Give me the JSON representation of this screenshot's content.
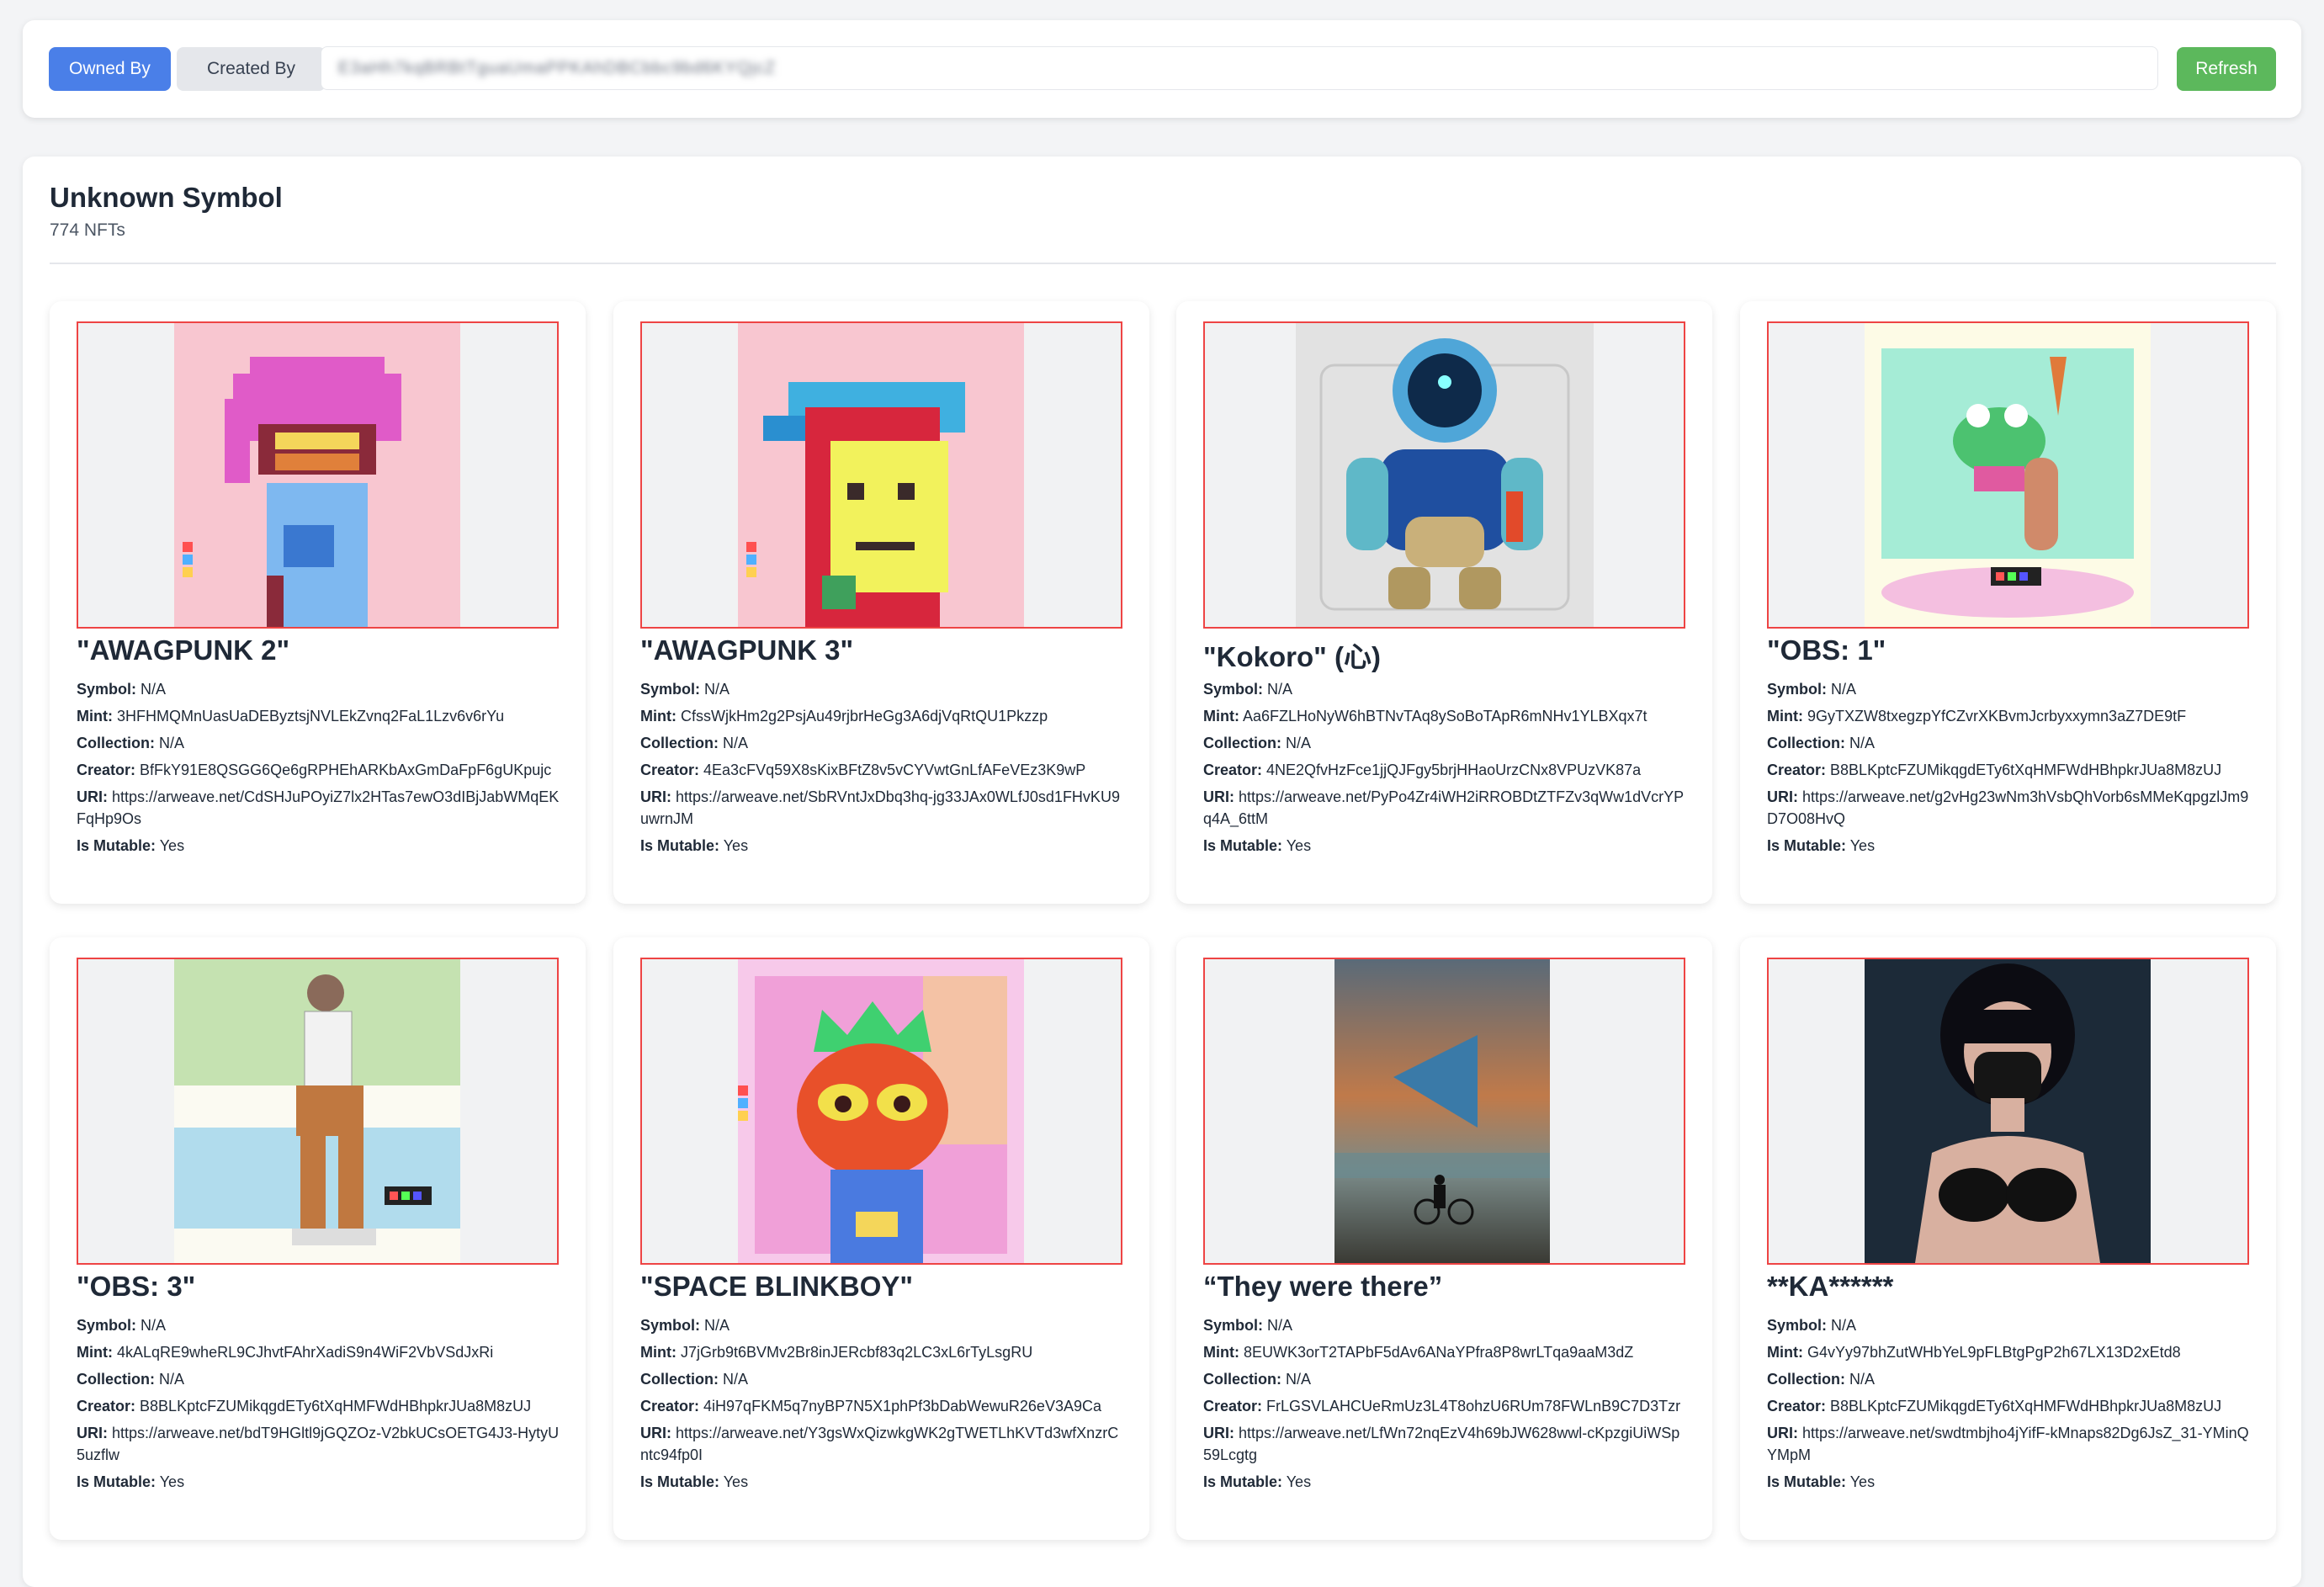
{
  "toolbar": {
    "owned_by_label": "Owned By",
    "created_by_label": "Created By",
    "address_value": "E3aHh7kqBRBtTguaUmaPPKAhDBCbbc9bd6KYQjcZ",
    "refresh_label": "Refresh"
  },
  "collection": {
    "title": "Unknown Symbol",
    "count": "774 NFTs"
  },
  "labels": {
    "symbol": "Symbol:",
    "mint": "Mint:",
    "collection": "Collection:",
    "creator": "Creator:",
    "uri": "URI:",
    "mutable": "Is Mutable:"
  },
  "cards": [
    {
      "name": "\"AWAGPUNK 2\"",
      "symbol": "N/A",
      "mint": "3HFHMQMnUasUaDEByztsjNVLEkZvnq2FaL1Lzv6v6rYu",
      "collection": "N/A",
      "creator": "BfFkY91E8QSGG6Qe6gRPHEhARKbAxGmDaFpF6gUKpujc",
      "uri": "https://arweave.net/CdSHJuPOyiZ7lx2HTas7ewO3dIBjJabWMqEKFqHp9Os",
      "mutable": "Yes",
      "image": "awagpunk2-image"
    },
    {
      "name": "\"AWAGPUNK 3\"",
      "symbol": "N/A",
      "mint": "CfssWjkHm2g2PsjAu49rjbrHeGg3A6djVqRtQU1Pkzzp",
      "collection": "N/A",
      "creator": "4Ea3cFVq59X8sKixBFtZ8v5vCYVwtGnLfAFeVEz3K9wP",
      "uri": "https://arweave.net/SbRVntJxDbq3hq-jg33JAx0WLfJ0sd1FHvKU9uwrnJM",
      "mutable": "Yes",
      "image": "awagpunk3-image"
    },
    {
      "name": "\"Kokoro\" (心)",
      "symbol": "N/A",
      "mint": "Aa6FZLHoNyW6hBTNvTAq8ySoBoTApR6mNHv1YLBXqx7t",
      "collection": "N/A",
      "creator": "4NE2QfvHzFce1jjQJFgy5brjHHaoUrzCNx8VPUzVK87a",
      "uri": "https://arweave.net/PyPo4Zr4iWH2iRROBDtZTFZv3qWw1dVcrYPq4A_6ttM",
      "mutable": "Yes",
      "image": "kokoro-image"
    },
    {
      "name": "\"OBS: 1\"",
      "symbol": "N/A",
      "mint": "9GyTXZW8txegzpYfCZvrXKBvmJcrbyxxymn3aZ7DE9tF",
      "collection": "N/A",
      "creator": "B8BLKptcFZUMikqgdETy6tXqHMFWdHBhpkrJUa8M8zUJ",
      "uri": "https://arweave.net/g2vHg23wNm3hVsbQhVorb6sMMeKqpgzlJm9D7O08HvQ",
      "mutable": "Yes",
      "image": "obs1-image"
    },
    {
      "name": "\"OBS: 3\"",
      "symbol": "N/A",
      "mint": "4kALqRE9wheRL9CJhvtFAhrXadiS9n4WiF2VbVSdJxRi",
      "collection": "N/A",
      "creator": "B8BLKptcFZUMikqgdETy6tXqHMFWdHBhpkrJUa8M8zUJ",
      "uri": "https://arweave.net/bdT9HGltl9jGQZOz-V2bkUCsOETG4J3-HytyU5uzflw",
      "mutable": "Yes",
      "image": "obs3-image"
    },
    {
      "name": "\"SPACE BLINKBOY\"",
      "symbol": "N/A",
      "mint": "J7jGrb9t6BVMv2Br8inJERcbf83q2LC3xL6rTyLsgRU",
      "collection": "N/A",
      "creator": "4iH97qFKM5q7nyBP7N5X1phPf3bDabWewuR26eV3A9Ca",
      "uri": "https://arweave.net/Y3gsWxQizwkgWK2gTWETLhKVTd3wfXnzrCntc94fp0I",
      "mutable": "Yes",
      "image": "space-blinkboy-image"
    },
    {
      "name": "“They were there”",
      "symbol": "N/A",
      "mint": "8EUWK3orT2TAPbF5dAv6ANaYPfra8P8wrLTqa9aaM3dZ",
      "collection": "N/A",
      "creator": "FrLGSVLAHCUeRmUz3L4T8ohzU6RUm78FWLnB9C7D3Tzr",
      "uri": "https://arweave.net/LfWn72nqEzV4h69bJW628wwl-cKpzgiUiWSp59Lcgtg",
      "mutable": "Yes",
      "image": "they-were-there-image"
    },
    {
      "name": "**KA******",
      "symbol": "N/A",
      "mint": "G4vYy97bhZutWHbYeL9pFLBtgPgP2h67LX13D2xEtd8",
      "collection": "N/A",
      "creator": "B8BLKptcFZUMikqgdETy6tXqHMFWdHBhpkrJUa8M8zUJ",
      "uri": "https://arweave.net/swdtmbjho4jYifF-kMnaps82Dg6JsZ_31-YMinQYMpM",
      "mutable": "Yes",
      "image": "ka-image"
    }
  ]
}
